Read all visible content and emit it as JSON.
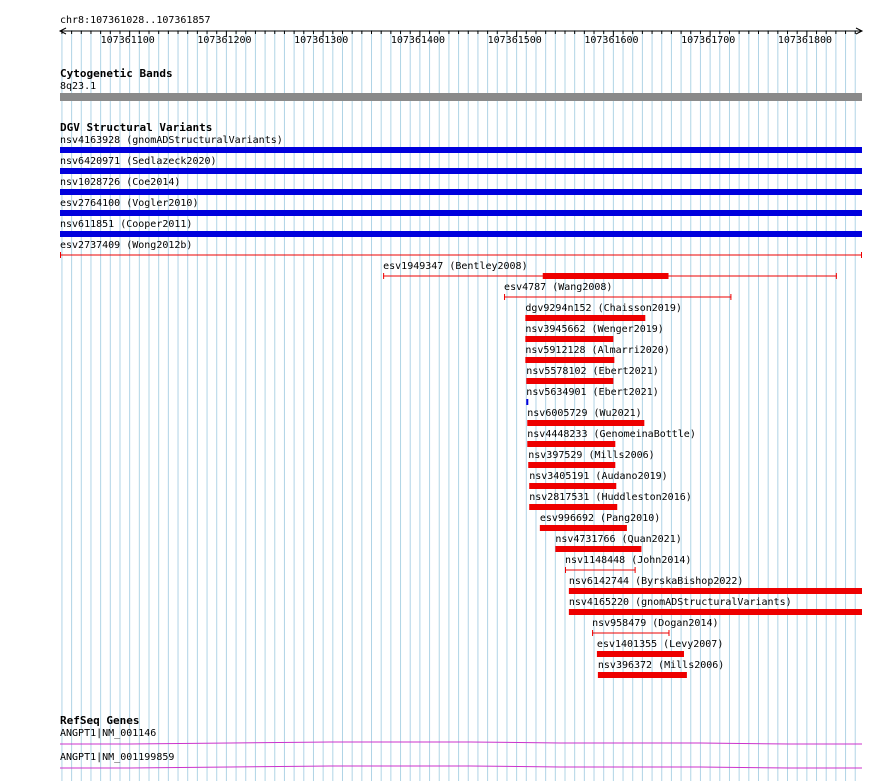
{
  "colors": {
    "grid": "#b0d4e6",
    "band": "#8a8a8a",
    "blue": "#0000dd",
    "red": "#ee0000",
    "refseq": "#cc33cc"
  },
  "ruler": {
    "location": "chr8:107361028..107361857",
    "start": 107361028,
    "end": 107361857,
    "ticks": [
      "107361100",
      "107361200",
      "107361300",
      "107361400",
      "107361500",
      "107361600",
      "107361700",
      "107361800"
    ]
  },
  "cytobands": {
    "title": "Cytogenetic Bands",
    "band_label": "8q23.1"
  },
  "dgv": {
    "title": "DGV Structural Variants",
    "features": [
      {
        "label": "nsv4163928 (gnomADStructuralVariants)",
        "start": 107361028,
        "end": 107361857,
        "color": "blue",
        "style": "bar"
      },
      {
        "label": "nsv6420971 (Sedlazeck2020)",
        "start": 107361028,
        "end": 107361857,
        "color": "blue",
        "style": "bar"
      },
      {
        "label": "nsv1028726 (Coe2014)",
        "start": 107361028,
        "end": 107361857,
        "color": "blue",
        "style": "bar"
      },
      {
        "label": "esv2764100 (Vogler2010)",
        "start": 107361028,
        "end": 107361857,
        "color": "blue",
        "style": "bar"
      },
      {
        "label": "nsv611851 (Cooper2011)",
        "start": 107361028,
        "end": 107361857,
        "color": "blue",
        "style": "bar"
      },
      {
        "label": "esv2737409 (Wong2012b)",
        "start": 107361028,
        "end": 107361857,
        "color": "red",
        "style": "line"
      },
      {
        "label": "esv1949347 (Bentley2008)",
        "start": 107361362,
        "end": 107361831,
        "color": "red",
        "style": "line",
        "thick_start": 107361527,
        "thick_end": 107361657
      },
      {
        "label": "esv4787 (Wang2008)",
        "start": 107361487,
        "end": 107361722,
        "color": "red",
        "style": "line"
      },
      {
        "label": "dgv9294n152 (Chaisson2019)",
        "start": 107361509,
        "end": 107361633,
        "color": "red",
        "style": "bar"
      },
      {
        "label": "nsv3945662 (Wenger2019)",
        "start": 107361509,
        "end": 107361600,
        "color": "red",
        "style": "bar"
      },
      {
        "label": "nsv5912128 (Almarri2020)",
        "start": 107361509,
        "end": 107361601,
        "color": "red",
        "style": "bar"
      },
      {
        "label": "nsv5578102 (Ebert2021)",
        "start": 107361510,
        "end": 107361600,
        "color": "red",
        "style": "bar"
      },
      {
        "label": "nsv5634901 (Ebert2021)",
        "start": 107361510,
        "end": 107361511,
        "color": "blue",
        "style": "bar"
      },
      {
        "label": "nsv6005729 (Wu2021)",
        "start": 107361511,
        "end": 107361632,
        "color": "red",
        "style": "bar"
      },
      {
        "label": "nsv4448233 (GenomeinaBottle)",
        "start": 107361511,
        "end": 107361602,
        "color": "red",
        "style": "bar"
      },
      {
        "label": "nsv397529 (Mills2006)",
        "start": 107361512,
        "end": 107361602,
        "color": "red",
        "style": "bar"
      },
      {
        "label": "nsv3405191 (Audano2019)",
        "start": 107361513,
        "end": 107361603,
        "color": "red",
        "style": "bar"
      },
      {
        "label": "nsv2817531 (Huddleston2016)",
        "start": 107361513,
        "end": 107361604,
        "color": "red",
        "style": "bar"
      },
      {
        "label": "esv996692 (Pang2010)",
        "start": 107361524,
        "end": 107361614,
        "color": "red",
        "style": "bar"
      },
      {
        "label": "nsv4731766 (Quan2021)",
        "start": 107361540,
        "end": 107361629,
        "color": "red",
        "style": "bar"
      },
      {
        "label": "nsv1148448 (John2014)",
        "start": 107361550,
        "end": 107361623,
        "color": "red",
        "style": "line"
      },
      {
        "label": "nsv6142744 (ByrskaBishop2022)",
        "start": 107361554,
        "end": 107361857,
        "color": "red",
        "style": "bar"
      },
      {
        "label": "nsv4165220 (gnomADStructuralVariants)",
        "start": 107361554,
        "end": 107361857,
        "color": "red",
        "style": "bar"
      },
      {
        "label": "nsv958479 (Dogan2014)",
        "start": 107361578,
        "end": 107361658,
        "color": "red",
        "style": "line"
      },
      {
        "label": "esv1401355 (Levy2007)",
        "start": 107361583,
        "end": 107361673,
        "color": "red",
        "style": "bar"
      },
      {
        "label": "nsv396372 (Mills2006)",
        "start": 107361584,
        "end": 107361676,
        "color": "red",
        "style": "bar"
      }
    ]
  },
  "refseq": {
    "title": "RefSeq Genes",
    "genes": [
      {
        "label": "ANGPT1|NM_001146"
      },
      {
        "label": "ANGPT1|NM_001199859"
      }
    ]
  }
}
